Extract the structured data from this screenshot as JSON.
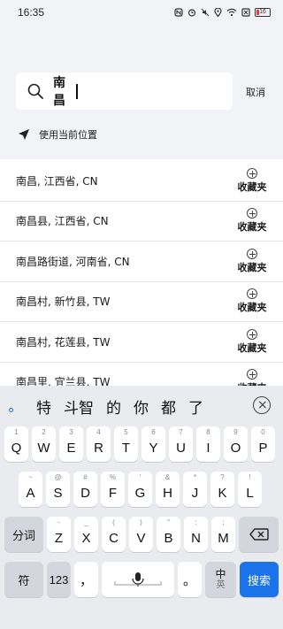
{
  "status_bar": {
    "time": "16:35",
    "battery": "16",
    "battery_color": "#e53935"
  },
  "search": {
    "value": "南昌",
    "search_icon": "search-icon",
    "cancel_label": "取消"
  },
  "location": {
    "icon": "navigation-arrow-icon",
    "label": "使用当前位置"
  },
  "results": [
    {
      "name": "南昌, 江西省, CN",
      "fav_label": "收藏夹"
    },
    {
      "name": "南昌县, 江西省, CN",
      "fav_label": "收藏夹"
    },
    {
      "name": "南昌路街道, 河南省, CN",
      "fav_label": "收藏夹"
    },
    {
      "name": "南昌村, 新竹县, TW",
      "fav_label": "收藏夹"
    },
    {
      "name": "南昌村, 花莲县, TW",
      "fav_label": "收藏夹"
    },
    {
      "name": "南昌里, 宜兰县, TW",
      "fav_label": "收藏夹"
    }
  ],
  "keyboard": {
    "candidates": [
      "特",
      "斗智",
      "的",
      "你",
      "都",
      "了"
    ],
    "row1": [
      {
        "sub": "1",
        "key": "Q"
      },
      {
        "sub": "2",
        "key": "W"
      },
      {
        "sub": "3",
        "key": "E"
      },
      {
        "sub": "4",
        "key": "R"
      },
      {
        "sub": "5",
        "key": "T"
      },
      {
        "sub": "6",
        "key": "Y"
      },
      {
        "sub": "7",
        "key": "U"
      },
      {
        "sub": "8",
        "key": "I"
      },
      {
        "sub": "9",
        "key": "O"
      },
      {
        "sub": "0",
        "key": "P"
      }
    ],
    "row2": [
      {
        "sub": "~",
        "key": "A"
      },
      {
        "sub": "@",
        "key": "S"
      },
      {
        "sub": "#",
        "key": "D"
      },
      {
        "sub": "%",
        "key": "F"
      },
      {
        "sub": "'",
        "key": "G"
      },
      {
        "sub": "&",
        "key": "H"
      },
      {
        "sub": "*",
        "key": "J"
      },
      {
        "sub": "?",
        "key": "K"
      },
      {
        "sub": "!",
        "key": "L"
      }
    ],
    "row3_left": "分词",
    "row3": [
      {
        "sub": "-",
        "key": "Z"
      },
      {
        "sub": "_",
        "key": "X"
      },
      {
        "sub": "(",
        "key": "C"
      },
      {
        "sub": ")",
        "key": "V"
      },
      {
        "sub": "\"",
        "key": "B"
      },
      {
        "sub": ":",
        "key": "N"
      },
      {
        "sub": ";",
        "key": "M"
      }
    ],
    "row4": {
      "symbol": "符",
      "num": "123",
      "comma": "，",
      "period": "。",
      "lang_top": "中",
      "lang_bottom": "英",
      "search": "搜索"
    },
    "accent_color": "#1a73e8"
  }
}
